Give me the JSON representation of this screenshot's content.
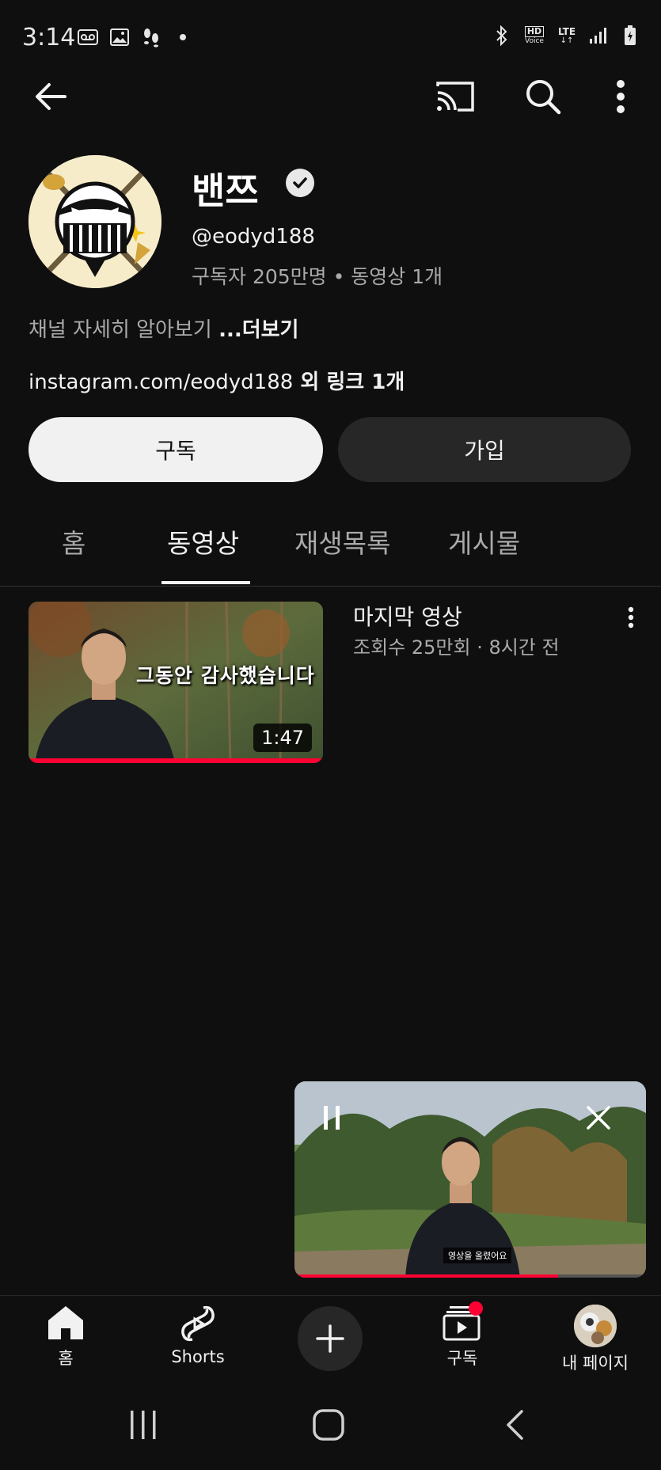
{
  "status_bar": {
    "time": "3:14",
    "left_icons": [
      "voicemail-icon",
      "image-icon",
      "footprint-icon",
      "dot-icon"
    ],
    "right_icons": [
      "bluetooth-icon",
      "hd-voice-icon",
      "lte-icon",
      "signal-icon",
      "battery-icon"
    ],
    "hd_label": "HD",
    "voice_label": "Voice",
    "lte_label": "LTE"
  },
  "top_bar": {
    "icons": [
      "back-arrow-icon",
      "cast-icon",
      "search-icon",
      "more-vert-icon"
    ]
  },
  "channel": {
    "name": "밴쯔",
    "handle": "@eodyd188",
    "meta": "구독자 205만명 • 동영상 1개",
    "about": "채널 자세히 알아보기 ",
    "about_more": "...더보기",
    "link": "instagram.com/eodyd188",
    "link_extra": " 외 링크 1개",
    "subscribe_label": "구독",
    "join_label": "가입"
  },
  "tabs": [
    {
      "label": "홈",
      "active": false
    },
    {
      "label": "동영상",
      "active": true
    },
    {
      "label": "재생목록",
      "active": false
    },
    {
      "label": "게시물",
      "active": false
    }
  ],
  "videos": [
    {
      "title": "마지막 영상",
      "meta": "조회수 25만회 · 8시간 전",
      "duration": "1:47",
      "overlay_text": "그동안 감사했습니다",
      "watched_progress": 1.0
    }
  ],
  "mini_player": {
    "caption": "영상을 올렸어요",
    "progress": 0.75
  },
  "bottom_nav": [
    {
      "label": "홈",
      "icon": "home-icon"
    },
    {
      "label": "Shorts",
      "icon": "shorts-icon"
    },
    {
      "label": "",
      "icon": "add-icon"
    },
    {
      "label": "구독",
      "icon": "subscriptions-icon",
      "badge": true
    },
    {
      "label": "내 페이지",
      "icon": "avatar-icon"
    }
  ],
  "system_nav": [
    "recents-icon",
    "home-circle-icon",
    "back-chevron-icon"
  ],
  "colors": {
    "background": "#0f0f0f",
    "accent_red": "#ff0033",
    "pill_dark": "#272727",
    "text_secondary": "#aaaaaa"
  }
}
